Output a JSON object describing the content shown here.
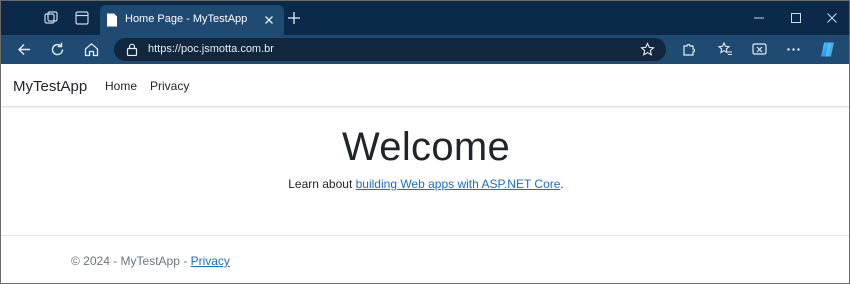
{
  "browser": {
    "tab_title": "Home Page - MyTestApp",
    "url": "https://poc.jsmotta.com.br",
    "icons": [
      "workspaces-icon",
      "tab-actions-icon",
      "page-favicon",
      "close-tab-icon",
      "new-tab-icon",
      "minimize-icon",
      "maximize-icon",
      "close-window-icon",
      "back-icon",
      "refresh-icon",
      "home-icon",
      "lock-icon",
      "favorite-star-icon",
      "extensions-icon",
      "favorites-icon",
      "screenshot-icon",
      "more-icon",
      "copilot-icon"
    ],
    "colors": {
      "tabstrip": "#0b2a4a",
      "toolbar": "#1f4a72",
      "address_bg": "#12263d"
    }
  },
  "navbar": {
    "brand": "MyTestApp",
    "links": [
      "Home",
      "Privacy"
    ]
  },
  "main": {
    "heading": "Welcome",
    "learn_prefix": "Learn about ",
    "learn_link": "building Web apps with ASP.NET Core",
    "learn_suffix": "."
  },
  "footer": {
    "text": "© 2024 - MyTestApp - ",
    "privacy_link": "Privacy"
  },
  "colors": {
    "link": "#1b6ec2",
    "text": "#212529",
    "muted": "#6c757d"
  }
}
